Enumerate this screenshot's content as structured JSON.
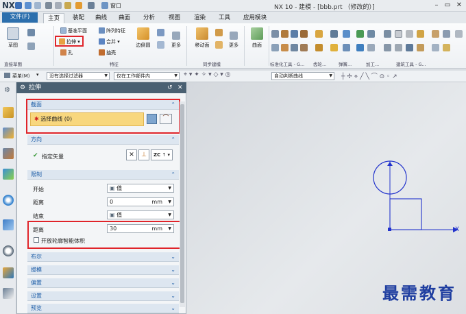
{
  "app": {
    "logo": "NX",
    "window_title": "NX 10 - 建模 - [bbb.prt （修改的）]",
    "window_menu": "窗口"
  },
  "tabs": [
    "文件(F)",
    "主页",
    "装配",
    "曲线",
    "曲面",
    "分析",
    "视图",
    "渲染",
    "工具",
    "应用模块"
  ],
  "ribbon": {
    "sketch": "草图",
    "datum_plane": "基准平面",
    "array_feature": "阵列特征",
    "extrude": "拉伸",
    "unite": "合并",
    "hole": "孔",
    "shell": "抽壳",
    "edge_blend": "边倒圆",
    "more": "更多",
    "move_face": "移动面",
    "surface": "曲面",
    "groups": {
      "direct_sketch": "直接草图",
      "feature": "特征",
      "sync_modeling": "同步建模",
      "std_tools": "标准化工具 - G...",
      "gear": "齿轮...",
      "spring": "弹簧...",
      "machining": "加工...",
      "building": "建筑工具 - G..."
    }
  },
  "toolbar2": {
    "menu": "菜单(M)",
    "filter": "没有选择过滤器",
    "scope": "仅在工作部件内",
    "curve_rule": "自动判断曲线"
  },
  "resource_bar": {
    "part_nav_label": "部"
  },
  "dialog": {
    "title": "拉伸",
    "section": {
      "header": "截面",
      "select_curve": "选择曲线 (0)"
    },
    "direction": {
      "header": "方向",
      "specify_vector": "指定矢量",
      "zc": "ZC"
    },
    "limits": {
      "header": "限制",
      "start_label": "开始",
      "start_value": "值",
      "distance1_label": "距离",
      "distance1_value": "0",
      "end_label": "结束",
      "end_value": "值",
      "distance2_label": "距离",
      "distance2_value": "30",
      "unit": "mm",
      "open_profile": "开放轮廓智能体积"
    },
    "collapsed": [
      "布尔",
      "拔模",
      "偏置",
      "设置",
      "预览"
    ]
  },
  "viewport": {
    "axis_x": "X"
  },
  "watermark": "最需教育",
  "colors": {
    "file_tab": "#2c6fad",
    "dialog_header": "#4a6072",
    "highlight": "#f8d77e",
    "red_box": "#e0242a",
    "sketch_blue": "#2233cc"
  }
}
